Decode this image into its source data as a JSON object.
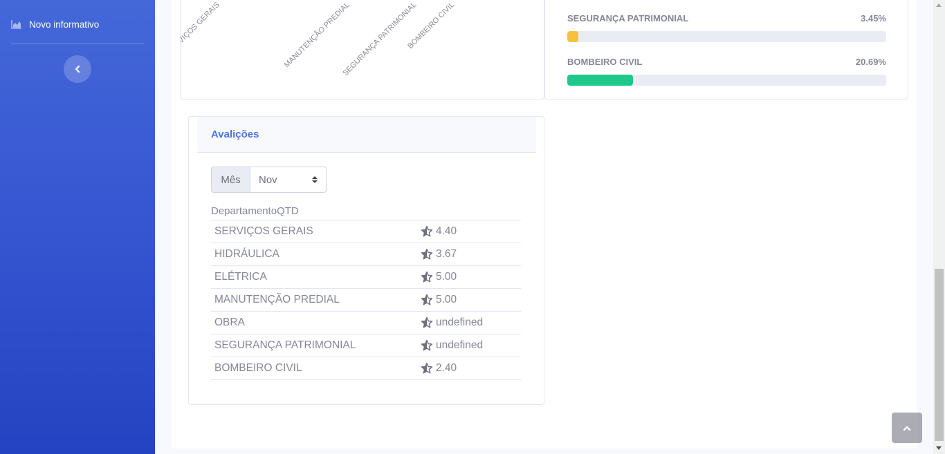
{
  "sidebar": {
    "nav_item_label": "Novo informativo",
    "nav_icon": "area-chart-icon",
    "toggle_icon": "chevron-left-icon"
  },
  "chart_card": {
    "x_tick_labels": [
      "SERVIÇOS GERAIS",
      "MANUTENÇÃO PREDIAL",
      "SEGURANÇA PATRIMONIAL",
      "BOMBEIRO CIVIL"
    ]
  },
  "progress_card": {
    "items": [
      {
        "label": "SEGURANÇA PATRIMONIAL",
        "percent_text": "3.45%",
        "value": 3.45,
        "color": "#f6c23e"
      },
      {
        "label": "BOMBEIRO CIVIL",
        "percent_text": "20.69%",
        "value": 20.69,
        "color": "#1cc88a"
      }
    ]
  },
  "avaliacoes": {
    "title": "Avalições",
    "month_prepend": "Mês",
    "month_selected": "Nov",
    "columns": [
      "Departamento",
      "QTD"
    ],
    "rows": [
      {
        "departamento": "SERVIÇOS GERAIS",
        "qtd": "4.40"
      },
      {
        "departamento": "HIDRÁULICA",
        "qtd": "3.67"
      },
      {
        "departamento": "ELÉTRICA",
        "qtd": "5.00"
      },
      {
        "departamento": "MANUTENÇÃO PREDIAL",
        "qtd": "5.00"
      },
      {
        "departamento": "OBRA",
        "qtd": "undefined"
      },
      {
        "departamento": "SEGURANÇA PATRIMONIAL",
        "qtd": "undefined"
      },
      {
        "departamento": "BOMBEIRO CIVIL",
        "qtd": "2.40"
      }
    ]
  },
  "colors": {
    "primary": "#4e73df",
    "warning": "#f6c23e",
    "success": "#1cc88a",
    "sidebar_top": "#4468d8",
    "sidebar_bottom": "#2443c2"
  },
  "scroll_top_icon": "chevron-up-icon"
}
